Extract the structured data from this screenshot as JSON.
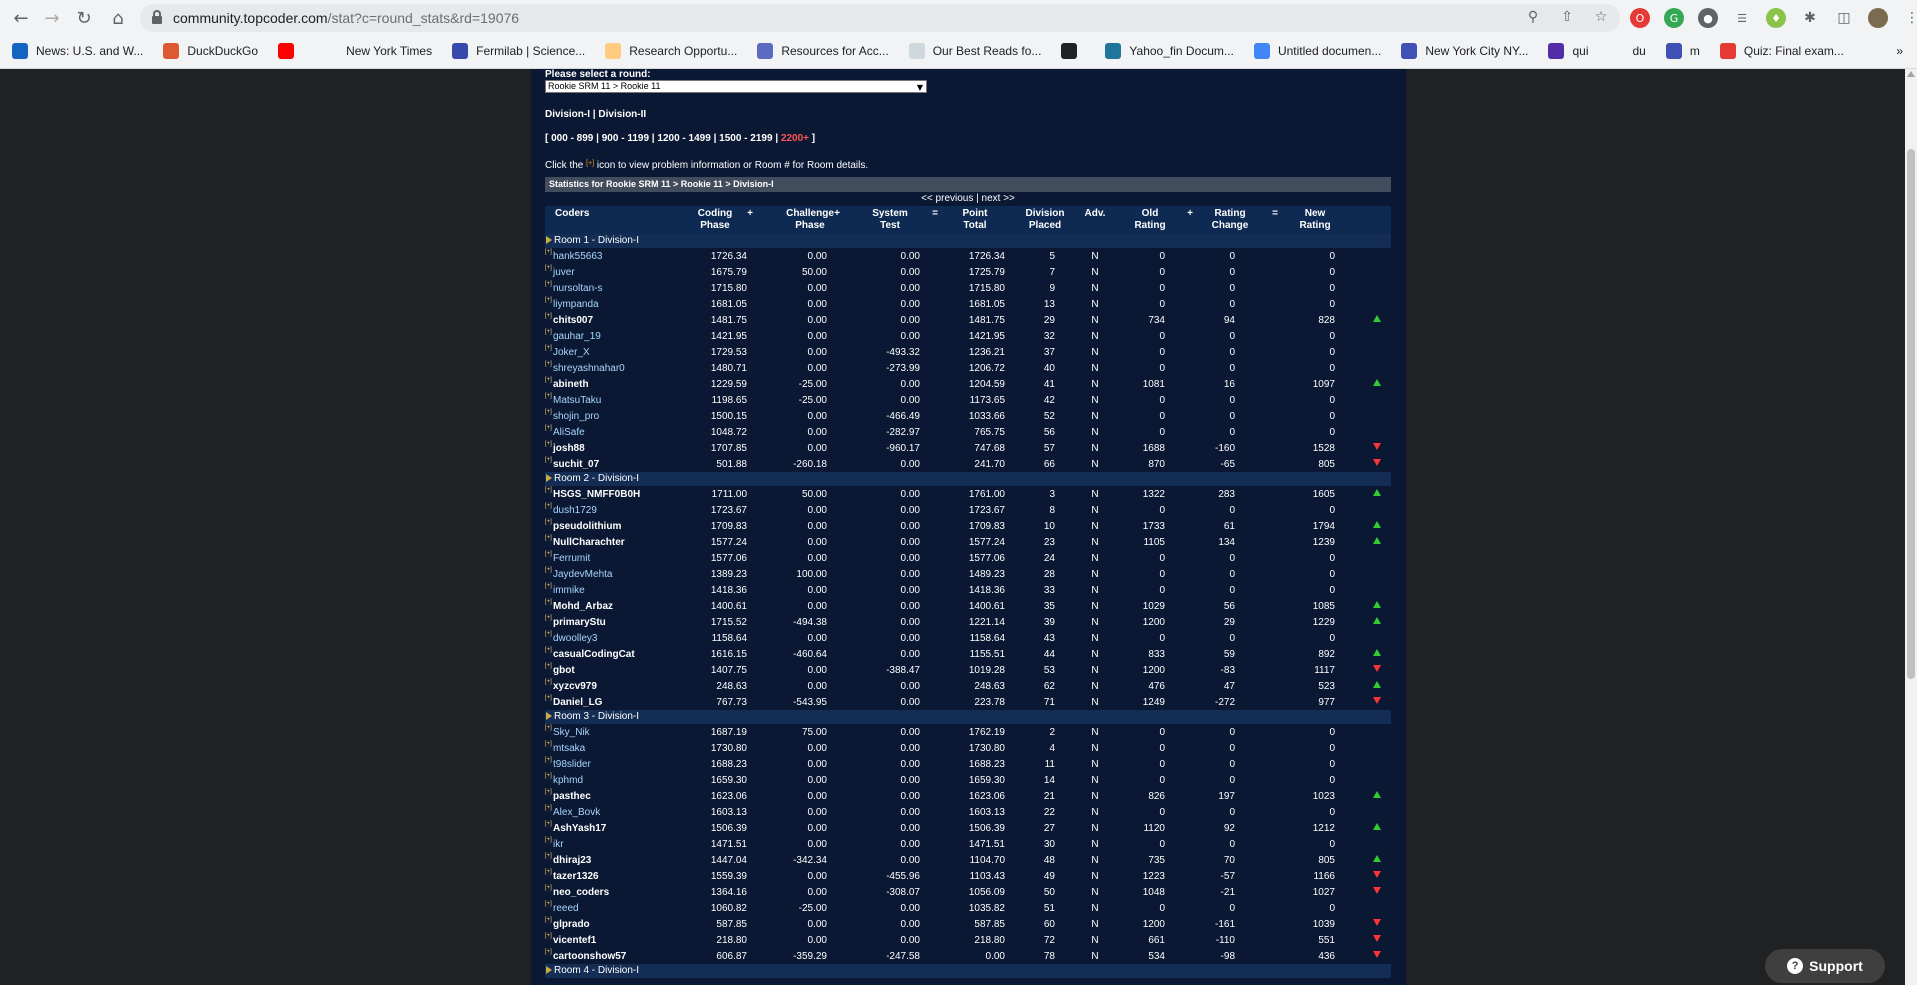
{
  "browser": {
    "url_host": "community.topcoder.com",
    "url_path": "/stat?c=round_stats&rd=19076",
    "bookmarks": [
      {
        "label": "News: U.S. and W...",
        "icon": "news-icon",
        "color": "#1565c0"
      },
      {
        "label": "DuckDuckGo",
        "icon": "duckduckgo-icon",
        "color": "#de5833"
      },
      {
        "label": "",
        "icon": "youtube-icon",
        "color": "#ff0000"
      },
      {
        "label": "New York Times",
        "icon": "nyt-icon",
        "color": "#f1f3f4"
      },
      {
        "label": "Fermilab | Science...",
        "icon": "fermilab-icon",
        "color": "#3949ab"
      },
      {
        "label": "Research Opportu...",
        "icon": "research-icon",
        "color": "#ffcc80"
      },
      {
        "label": "Resources for Acc...",
        "icon": "docs-icon",
        "color": "#5c6bc0"
      },
      {
        "label": "Our Best Reads fo...",
        "icon": "reads-icon",
        "color": "#cfd8dc"
      },
      {
        "label": "",
        "icon": "globe-icon",
        "color": "#202124"
      },
      {
        "label": "Yahoo_fin Docum...",
        "icon": "wordpress-icon",
        "color": "#21759b"
      },
      {
        "label": "Untitled documen...",
        "icon": "docs-icon",
        "color": "#4285f4"
      },
      {
        "label": "New York City NY...",
        "icon": "nyc-icon",
        "color": "#3f51b5"
      },
      {
        "label": "qui",
        "icon": "qui-icon",
        "color": "#512da8"
      },
      {
        "label": "du",
        "icon": "wikipedia-icon",
        "color": "#f1f3f4"
      },
      {
        "label": "m",
        "icon": "shield-icon",
        "color": "#3f51b5"
      },
      {
        "label": "Quiz: Final exam...",
        "icon": "quiz-icon",
        "color": "#e53935"
      }
    ]
  },
  "page": {
    "select_label": "Please select a round:",
    "round_selected": "Rookie SRM 11 > Rookie 11",
    "division_links": [
      "Division-I",
      "Division-II"
    ],
    "rating_ranges": [
      "000 - 899",
      "900 - 1199",
      "1200 - 1499",
      "1500 - 2199",
      "2200+"
    ],
    "help_text_before": "Click the",
    "help_text_icon": "[+]",
    "help_text_after": "icon to view problem information or Room # for Room details.",
    "table_title": "Statistics for Rookie SRM 11 > Rookie 11 > Division-I",
    "prev": "<< previous",
    "next": "next >>",
    "separator": "|",
    "headers": {
      "coders": "Coders",
      "coding": "Coding\nPhase",
      "plus1": "+",
      "challenge": "Challenge\nPhase",
      "plus2": "+",
      "system": "System\nTest",
      "eq1": "=",
      "point": "Point\nTotal",
      "placed": "Division\nPlaced",
      "adv": "Adv.",
      "old": "Old\nRating",
      "plus3": "+",
      "change": "Rating\nChange",
      "eq2": "=",
      "new": "New\nRating"
    },
    "rooms": [
      {
        "title": "Room 1 - Division-I",
        "rows": [
          {
            "name": "hank55663",
            "bold": false,
            "coding": "1726.34",
            "challenge": "0.00",
            "system": "0.00",
            "total": "1726.34",
            "placed": "5",
            "adv": "N",
            "old": "0",
            "change": "0",
            "new": "0",
            "trend": ""
          },
          {
            "name": "juver",
            "bold": false,
            "coding": "1675.79",
            "challenge": "50.00",
            "system": "0.00",
            "total": "1725.79",
            "placed": "7",
            "adv": "N",
            "old": "0",
            "change": "0",
            "new": "0",
            "trend": ""
          },
          {
            "name": "nursoltan-s",
            "bold": false,
            "coding": "1715.80",
            "challenge": "0.00",
            "system": "0.00",
            "total": "1715.80",
            "placed": "9",
            "adv": "N",
            "old": "0",
            "change": "0",
            "new": "0",
            "trend": ""
          },
          {
            "name": "liympanda",
            "bold": false,
            "coding": "1681.05",
            "challenge": "0.00",
            "system": "0.00",
            "total": "1681.05",
            "placed": "13",
            "adv": "N",
            "old": "0",
            "change": "0",
            "new": "0",
            "trend": ""
          },
          {
            "name": "chits007",
            "bold": true,
            "coding": "1481.75",
            "challenge": "0.00",
            "system": "0.00",
            "total": "1481.75",
            "placed": "29",
            "adv": "N",
            "old": "734",
            "change": "94",
            "new": "828",
            "trend": "up"
          },
          {
            "name": "gauhar_19",
            "bold": false,
            "coding": "1421.95",
            "challenge": "0.00",
            "system": "0.00",
            "total": "1421.95",
            "placed": "32",
            "adv": "N",
            "old": "0",
            "change": "0",
            "new": "0",
            "trend": ""
          },
          {
            "name": "Joker_X",
            "bold": false,
            "coding": "1729.53",
            "challenge": "0.00",
            "system": "-493.32",
            "total": "1236.21",
            "placed": "37",
            "adv": "N",
            "old": "0",
            "change": "0",
            "new": "0",
            "trend": ""
          },
          {
            "name": "shreyashnahar0",
            "bold": false,
            "coding": "1480.71",
            "challenge": "0.00",
            "system": "-273.99",
            "total": "1206.72",
            "placed": "40",
            "adv": "N",
            "old": "0",
            "change": "0",
            "new": "0",
            "trend": ""
          },
          {
            "name": "abineth",
            "bold": true,
            "coding": "1229.59",
            "challenge": "-25.00",
            "system": "0.00",
            "total": "1204.59",
            "placed": "41",
            "adv": "N",
            "old": "1081",
            "change": "16",
            "new": "1097",
            "trend": "up"
          },
          {
            "name": "MatsuTaku",
            "bold": false,
            "coding": "1198.65",
            "challenge": "-25.00",
            "system": "0.00",
            "total": "1173.65",
            "placed": "42",
            "adv": "N",
            "old": "0",
            "change": "0",
            "new": "0",
            "trend": ""
          },
          {
            "name": "shojin_pro",
            "bold": false,
            "coding": "1500.15",
            "challenge": "0.00",
            "system": "-466.49",
            "total": "1033.66",
            "placed": "52",
            "adv": "N",
            "old": "0",
            "change": "0",
            "new": "0",
            "trend": ""
          },
          {
            "name": "AliSafe",
            "bold": false,
            "coding": "1048.72",
            "challenge": "0.00",
            "system": "-282.97",
            "total": "765.75",
            "placed": "56",
            "adv": "N",
            "old": "0",
            "change": "0",
            "new": "0",
            "trend": ""
          },
          {
            "name": "josh88",
            "bold": true,
            "coding": "1707.85",
            "challenge": "0.00",
            "system": "-960.17",
            "total": "747.68",
            "placed": "57",
            "adv": "N",
            "old": "1688",
            "change": "-160",
            "new": "1528",
            "trend": "down"
          },
          {
            "name": "suchit_07",
            "bold": true,
            "coding": "501.88",
            "challenge": "-260.18",
            "system": "0.00",
            "total": "241.70",
            "placed": "66",
            "adv": "N",
            "old": "870",
            "change": "-65",
            "new": "805",
            "trend": "down"
          }
        ]
      },
      {
        "title": "Room 2 - Division-I",
        "rows": [
          {
            "name": "HSGS_NMFF0B0H",
            "bold": true,
            "coding": "1711.00",
            "challenge": "50.00",
            "system": "0.00",
            "total": "1761.00",
            "placed": "3",
            "adv": "N",
            "old": "1322",
            "change": "283",
            "new": "1605",
            "trend": "up"
          },
          {
            "name": "dush1729",
            "bold": false,
            "coding": "1723.67",
            "challenge": "0.00",
            "system": "0.00",
            "total": "1723.67",
            "placed": "8",
            "adv": "N",
            "old": "0",
            "change": "0",
            "new": "0",
            "trend": ""
          },
          {
            "name": "pseudolithium",
            "bold": true,
            "coding": "1709.83",
            "challenge": "0.00",
            "system": "0.00",
            "total": "1709.83",
            "placed": "10",
            "adv": "N",
            "old": "1733",
            "change": "61",
            "new": "1794",
            "trend": "up"
          },
          {
            "name": "NullCharachter",
            "bold": true,
            "coding": "1577.24",
            "challenge": "0.00",
            "system": "0.00",
            "total": "1577.24",
            "placed": "23",
            "adv": "N",
            "old": "1105",
            "change": "134",
            "new": "1239",
            "trend": "up"
          },
          {
            "name": "Ferrumit",
            "bold": false,
            "coding": "1577.06",
            "challenge": "0.00",
            "system": "0.00",
            "total": "1577.06",
            "placed": "24",
            "adv": "N",
            "old": "0",
            "change": "0",
            "new": "0",
            "trend": ""
          },
          {
            "name": "JaydevMehta",
            "bold": false,
            "coding": "1389.23",
            "challenge": "100.00",
            "system": "0.00",
            "total": "1489.23",
            "placed": "28",
            "adv": "N",
            "old": "0",
            "change": "0",
            "new": "0",
            "trend": ""
          },
          {
            "name": "immike",
            "bold": false,
            "coding": "1418.36",
            "challenge": "0.00",
            "system": "0.00",
            "total": "1418.36",
            "placed": "33",
            "adv": "N",
            "old": "0",
            "change": "0",
            "new": "0",
            "trend": ""
          },
          {
            "name": "Mohd_Arbaz",
            "bold": true,
            "coding": "1400.61",
            "challenge": "0.00",
            "system": "0.00",
            "total": "1400.61",
            "placed": "35",
            "adv": "N",
            "old": "1029",
            "change": "56",
            "new": "1085",
            "trend": "up"
          },
          {
            "name": "primaryStu",
            "bold": true,
            "coding": "1715.52",
            "challenge": "-494.38",
            "system": "0.00",
            "total": "1221.14",
            "placed": "39",
            "adv": "N",
            "old": "1200",
            "change": "29",
            "new": "1229",
            "trend": "up"
          },
          {
            "name": "dwoolley3",
            "bold": false,
            "coding": "1158.64",
            "challenge": "0.00",
            "system": "0.00",
            "total": "1158.64",
            "placed": "43",
            "adv": "N",
            "old": "0",
            "change": "0",
            "new": "0",
            "trend": ""
          },
          {
            "name": "casualCodingCat",
            "bold": true,
            "coding": "1616.15",
            "challenge": "-460.64",
            "system": "0.00",
            "total": "1155.51",
            "placed": "44",
            "adv": "N",
            "old": "833",
            "change": "59",
            "new": "892",
            "trend": "up"
          },
          {
            "name": "gbot",
            "bold": true,
            "coding": "1407.75",
            "challenge": "0.00",
            "system": "-388.47",
            "total": "1019.28",
            "placed": "53",
            "adv": "N",
            "old": "1200",
            "change": "-83",
            "new": "1117",
            "trend": "down"
          },
          {
            "name": "xyzcv979",
            "bold": true,
            "coding": "248.63",
            "challenge": "0.00",
            "system": "0.00",
            "total": "248.63",
            "placed": "62",
            "adv": "N",
            "old": "476",
            "change": "47",
            "new": "523",
            "trend": "up"
          },
          {
            "name": "Daniel_LG",
            "bold": true,
            "coding": "767.73",
            "challenge": "-543.95",
            "system": "0.00",
            "total": "223.78",
            "placed": "71",
            "adv": "N",
            "old": "1249",
            "change": "-272",
            "new": "977",
            "trend": "down"
          }
        ]
      },
      {
        "title": "Room 3 - Division-I",
        "rows": [
          {
            "name": "Sky_Nik",
            "bold": false,
            "coding": "1687.19",
            "challenge": "75.00",
            "system": "0.00",
            "total": "1762.19",
            "placed": "2",
            "adv": "N",
            "old": "0",
            "change": "0",
            "new": "0",
            "trend": ""
          },
          {
            "name": "mtsaka",
            "bold": false,
            "coding": "1730.80",
            "challenge": "0.00",
            "system": "0.00",
            "total": "1730.80",
            "placed": "4",
            "adv": "N",
            "old": "0",
            "change": "0",
            "new": "0",
            "trend": ""
          },
          {
            "name": "t98slider",
            "bold": false,
            "coding": "1688.23",
            "challenge": "0.00",
            "system": "0.00",
            "total": "1688.23",
            "placed": "11",
            "adv": "N",
            "old": "0",
            "change": "0",
            "new": "0",
            "trend": ""
          },
          {
            "name": "kphmd",
            "bold": false,
            "coding": "1659.30",
            "challenge": "0.00",
            "system": "0.00",
            "total": "1659.30",
            "placed": "14",
            "adv": "N",
            "old": "0",
            "change": "0",
            "new": "0",
            "trend": ""
          },
          {
            "name": "pasthec",
            "bold": true,
            "coding": "1623.06",
            "challenge": "0.00",
            "system": "0.00",
            "total": "1623.06",
            "placed": "21",
            "adv": "N",
            "old": "826",
            "change": "197",
            "new": "1023",
            "trend": "up"
          },
          {
            "name": "Alex_Bovk",
            "bold": false,
            "coding": "1603.13",
            "challenge": "0.00",
            "system": "0.00",
            "total": "1603.13",
            "placed": "22",
            "adv": "N",
            "old": "0",
            "change": "0",
            "new": "0",
            "trend": ""
          },
          {
            "name": "AshYash17",
            "bold": true,
            "coding": "1506.39",
            "challenge": "0.00",
            "system": "0.00",
            "total": "1506.39",
            "placed": "27",
            "adv": "N",
            "old": "1120",
            "change": "92",
            "new": "1212",
            "trend": "up"
          },
          {
            "name": "ikr",
            "bold": false,
            "coding": "1471.51",
            "challenge": "0.00",
            "system": "0.00",
            "total": "1471.51",
            "placed": "30",
            "adv": "N",
            "old": "0",
            "change": "0",
            "new": "0",
            "trend": ""
          },
          {
            "name": "dhiraj23",
            "bold": true,
            "coding": "1447.04",
            "challenge": "-342.34",
            "system": "0.00",
            "total": "1104.70",
            "placed": "48",
            "adv": "N",
            "old": "735",
            "change": "70",
            "new": "805",
            "trend": "up"
          },
          {
            "name": "tazer1326",
            "bold": true,
            "coding": "1559.39",
            "challenge": "0.00",
            "system": "-455.96",
            "total": "1103.43",
            "placed": "49",
            "adv": "N",
            "old": "1223",
            "change": "-57",
            "new": "1166",
            "trend": "down"
          },
          {
            "name": "neo_coders",
            "bold": true,
            "coding": "1364.16",
            "challenge": "0.00",
            "system": "-308.07",
            "total": "1056.09",
            "placed": "50",
            "adv": "N",
            "old": "1048",
            "change": "-21",
            "new": "1027",
            "trend": "down"
          },
          {
            "name": "reeed",
            "bold": false,
            "coding": "1060.82",
            "challenge": "-25.00",
            "system": "0.00",
            "total": "1035.82",
            "placed": "51",
            "adv": "N",
            "old": "0",
            "change": "0",
            "new": "0",
            "trend": ""
          },
          {
            "name": "glprado",
            "bold": true,
            "coding": "587.85",
            "challenge": "0.00",
            "system": "0.00",
            "total": "587.85",
            "placed": "60",
            "adv": "N",
            "old": "1200",
            "change": "-161",
            "new": "1039",
            "trend": "down"
          },
          {
            "name": "vicentef1",
            "bold": true,
            "coding": "218.80",
            "challenge": "0.00",
            "system": "0.00",
            "total": "218.80",
            "placed": "72",
            "adv": "N",
            "old": "661",
            "change": "-110",
            "new": "551",
            "trend": "down"
          },
          {
            "name": "cartoonshow57",
            "bold": true,
            "coding": "606.87",
            "challenge": "-359.29",
            "system": "-247.58",
            "total": "0.00",
            "placed": "78",
            "adv": "N",
            "old": "534",
            "change": "-98",
            "new": "436",
            "trend": "down"
          }
        ]
      },
      {
        "title": "Room 4 - Division-I",
        "rows": []
      }
    ]
  },
  "support": {
    "label": "Support",
    "icon": "question-icon"
  }
}
